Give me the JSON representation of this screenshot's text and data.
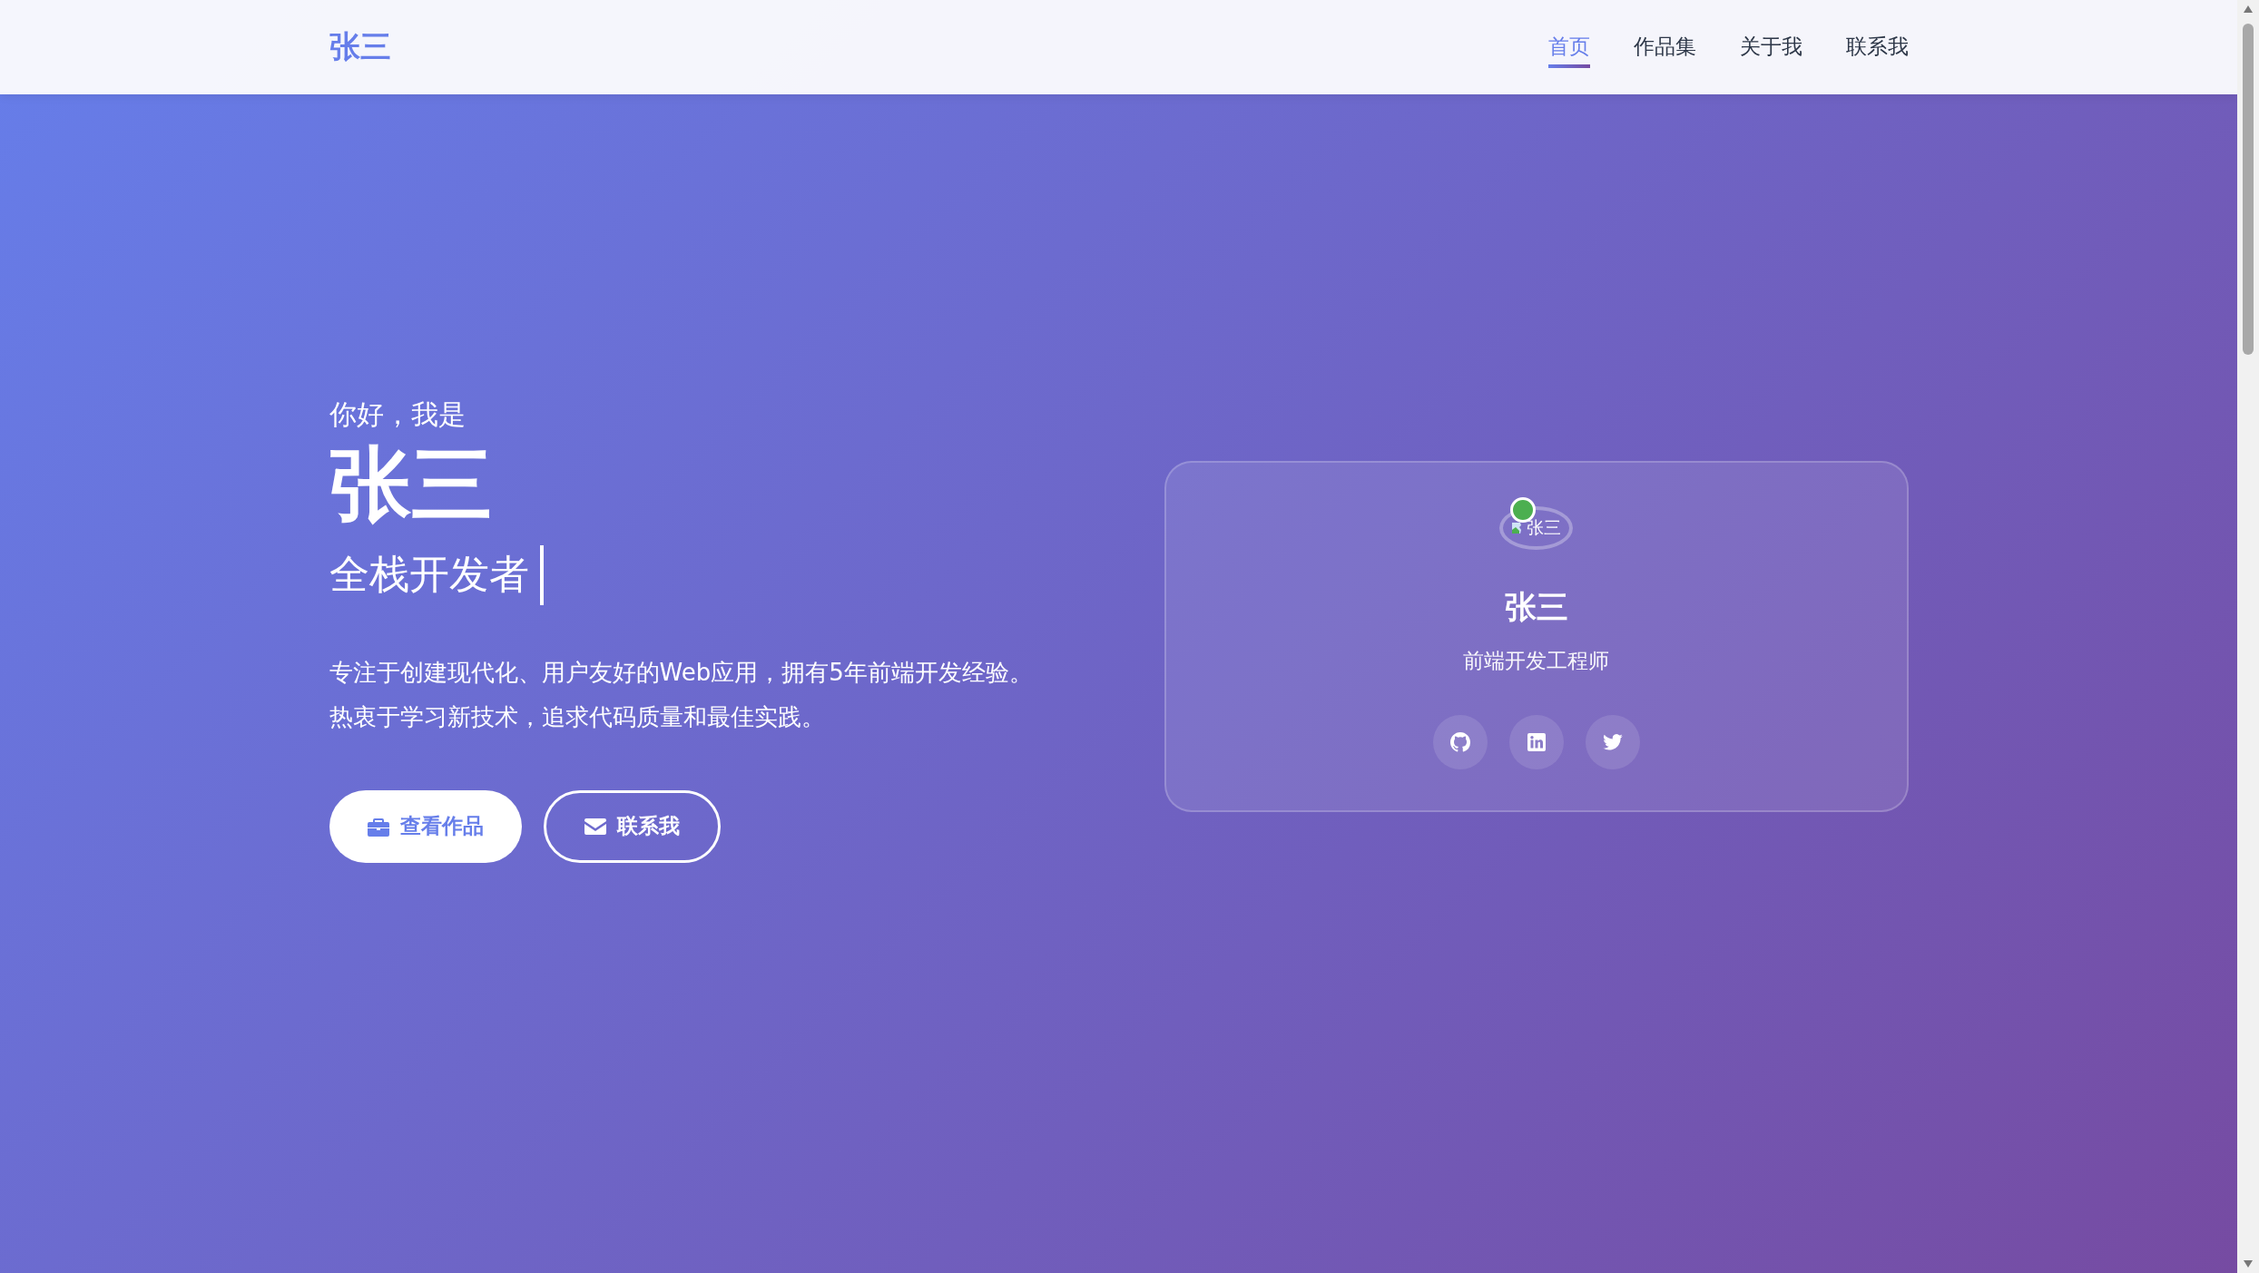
{
  "header": {
    "logo": "张三",
    "nav": [
      {
        "label": "首页",
        "selected": true
      },
      {
        "label": "作品集",
        "selected": false
      },
      {
        "label": "关于我",
        "selected": false
      },
      {
        "label": "联系我",
        "selected": false
      }
    ]
  },
  "hero": {
    "greeting": "你好，我是",
    "name": "张三",
    "role": "全栈开发者",
    "description": [
      "专注于创建现代化、用户友好的Web应用，拥有5年前端开发经验。",
      "热衷于学习新技术，追求代码质量和最佳实践。"
    ],
    "buttons": [
      {
        "label": "查看作品",
        "kind": "primary"
      },
      {
        "label": "联系我",
        "kind": "outline"
      }
    ]
  },
  "card": {
    "avatar_alt": "张三",
    "online": true,
    "name": "张三",
    "title": "前端开发工程师",
    "socials": [
      {
        "kind": "github"
      },
      {
        "kind": "linkedin"
      },
      {
        "kind": "twitter"
      }
    ]
  }
}
